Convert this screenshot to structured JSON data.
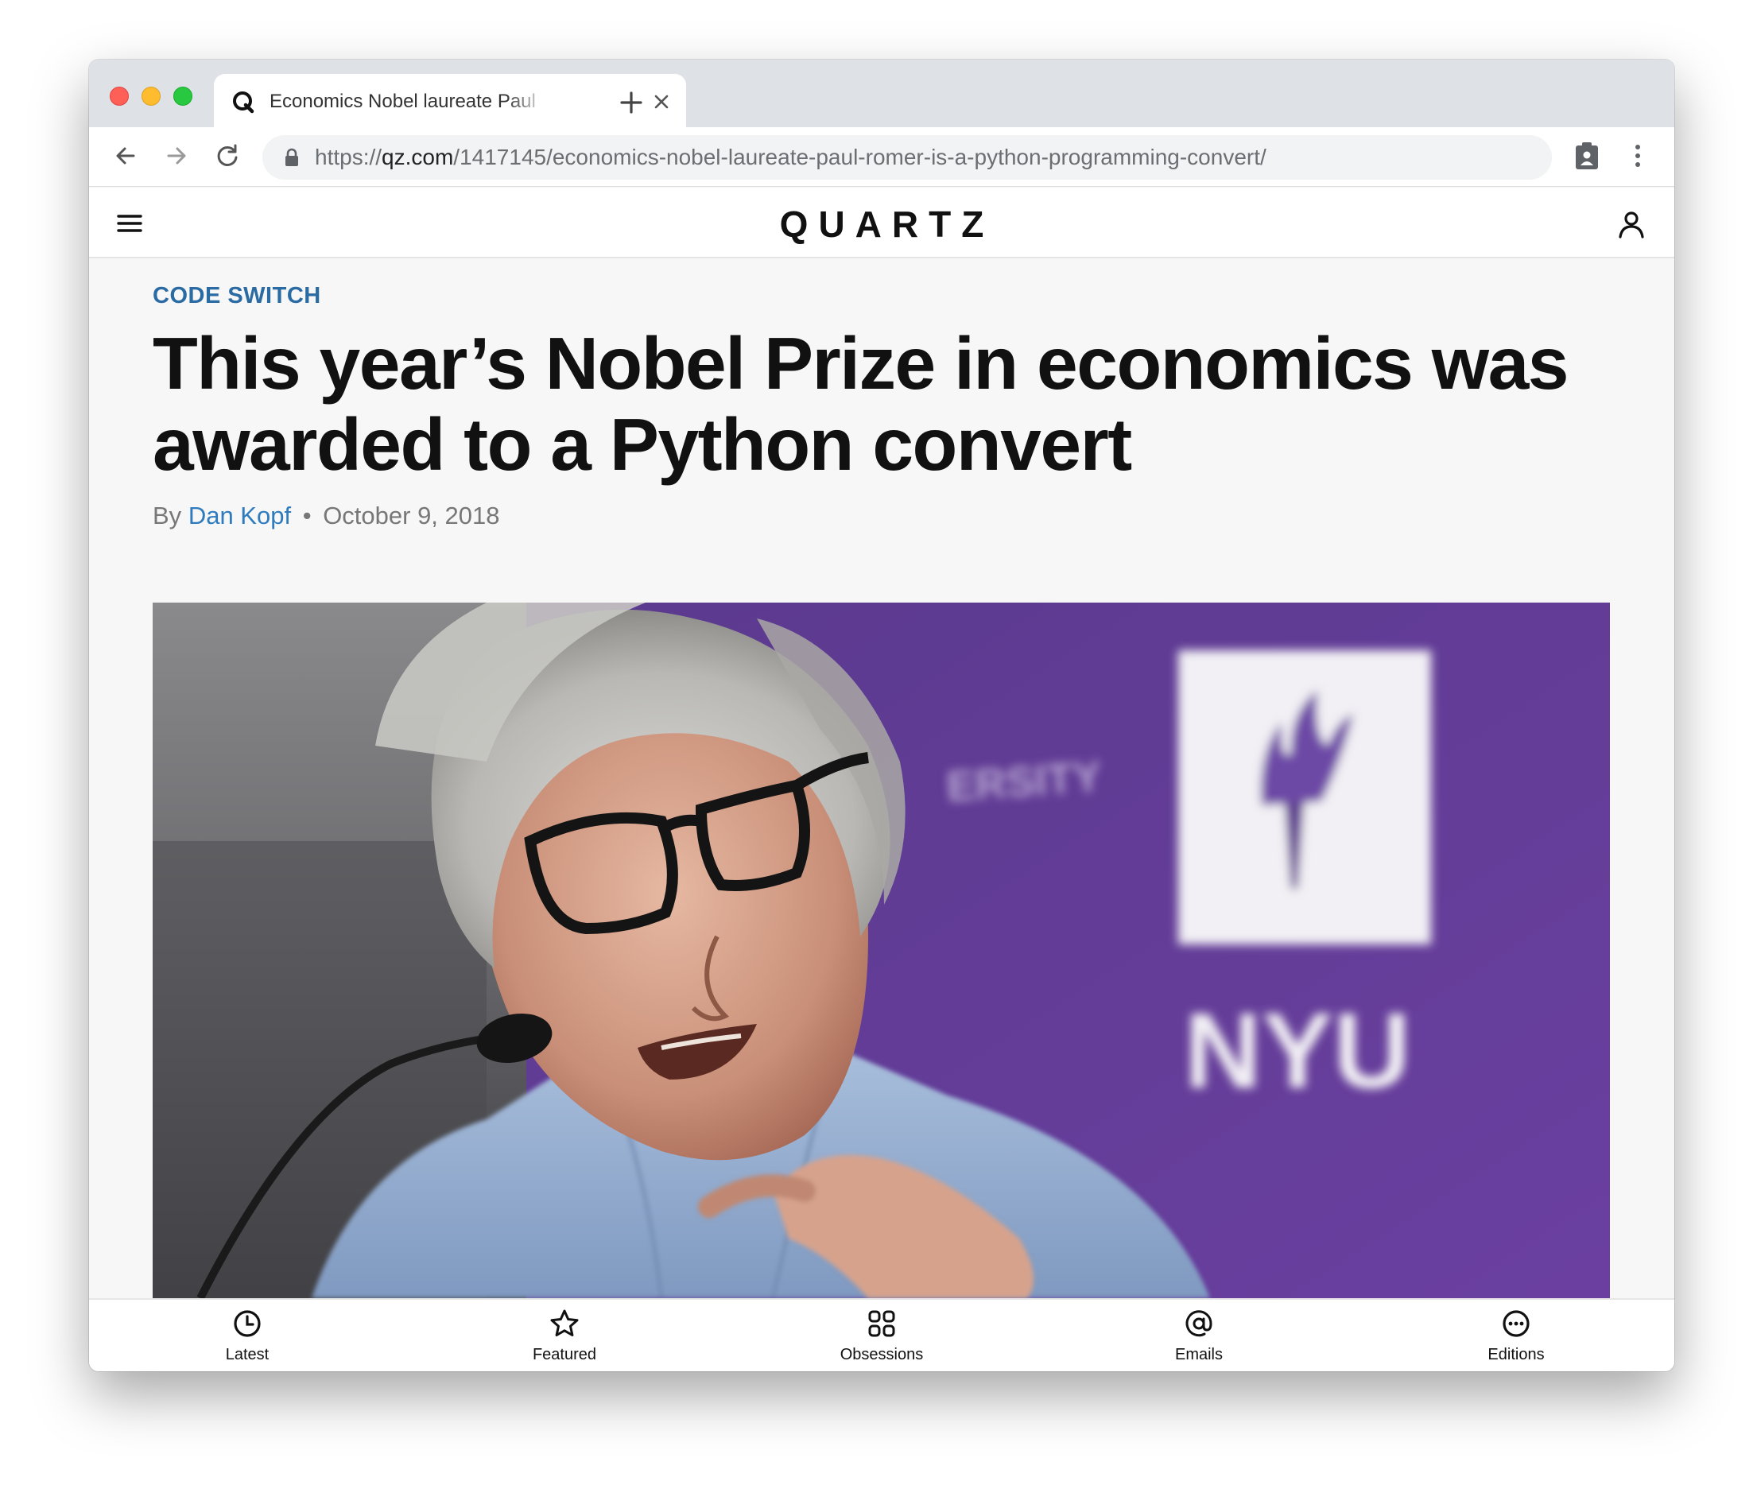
{
  "browser": {
    "tab_title": "Economics Nobel laureate Paul",
    "url_prefix": "https://",
    "url_host": "qz.com",
    "url_path": "/1417145/economics-nobel-laureate-paul-romer-is-a-python-programming-convert/"
  },
  "site": {
    "logo": "QUARTZ"
  },
  "article": {
    "kicker": "CODE SWITCH",
    "headline": "This year’s Nobel Prize in economics was awarded to a Python convert",
    "byline_prefix": "By",
    "author": "Dan Kopf",
    "separator": "•",
    "date": "October 9, 2018"
  },
  "hero_image": {
    "sign_text": "NYU",
    "backdrop_text": "ERSITY",
    "caption_mark": "≥"
  },
  "bottom_nav": [
    {
      "label": "Latest",
      "icon": "clock-icon"
    },
    {
      "label": "Featured",
      "icon": "star-icon"
    },
    {
      "label": "Obsessions",
      "icon": "grid-icon"
    },
    {
      "label": "Emails",
      "icon": "at-icon"
    },
    {
      "label": "Editions",
      "icon": "more-icon"
    }
  ],
  "colors": {
    "kicker": "#2a6ba3",
    "author_link": "#2e7bbd",
    "nyu_purple": "#5b3a8e"
  }
}
